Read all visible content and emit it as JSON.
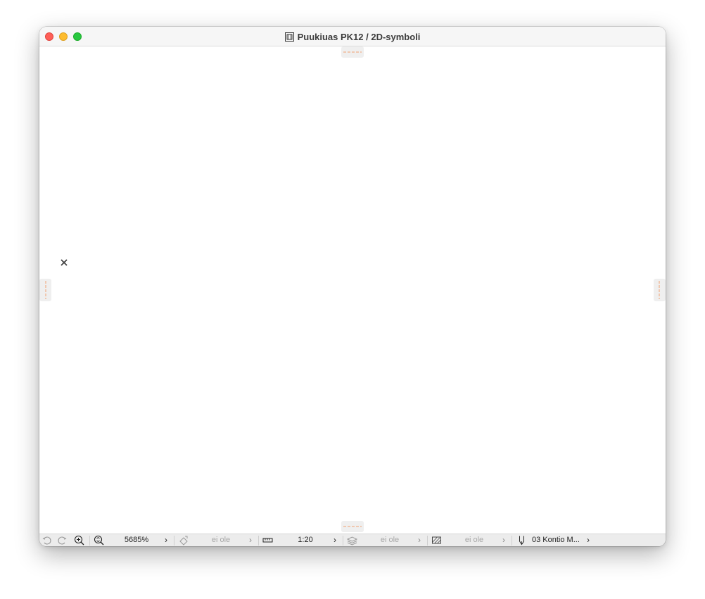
{
  "window": {
    "title": "Puukiuas PK12 / 2D-symboli",
    "title_icon": "window-frame-icon"
  },
  "canvas": {
    "origin_marker": "origin-cross-icon",
    "edge_handles": [
      "top",
      "bottom",
      "left",
      "right"
    ]
  },
  "statusbar": {
    "undo_icon": "undo-icon",
    "redo_icon": "redo-icon",
    "zoom_in_icon": "zoom-in-icon",
    "fit_icon": "zoom-fit-icon",
    "zoom_value": "5685%",
    "orientation": {
      "icon": "rotate-view-icon",
      "value": "ei ole"
    },
    "scale": {
      "icon": "ruler-icon",
      "value": "1:20"
    },
    "layers": {
      "icon": "layers-icon",
      "value": "ei ole"
    },
    "override": {
      "icon": "hatch-icon",
      "value": "ei ole"
    },
    "pen_set": {
      "icon": "pen-icon",
      "value": "03 Kontio M..."
    }
  },
  "colors": {
    "accent_dash": "#f0a070",
    "close": "#fe5f57",
    "minimize": "#febc2e",
    "zoom": "#28c840"
  }
}
